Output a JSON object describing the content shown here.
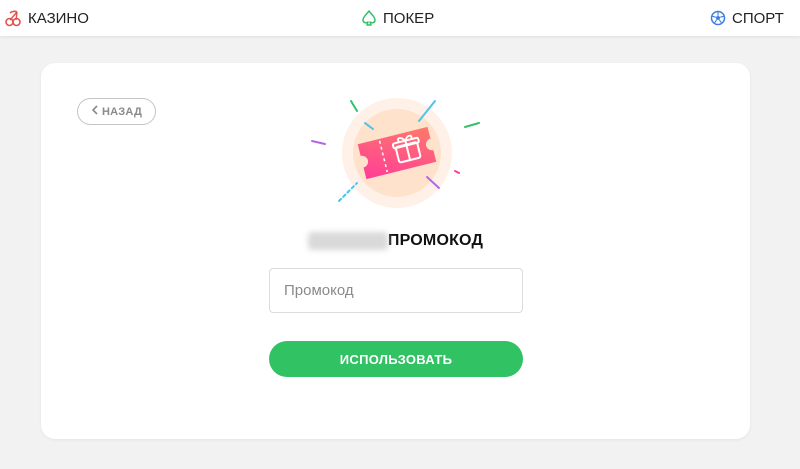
{
  "nav": {
    "casino": {
      "label": "КАЗИНО",
      "icon": "cherries-icon",
      "color": "#e0534f"
    },
    "poker": {
      "label": "ПОКЕР",
      "icon": "spade-icon",
      "color": "#33c16a"
    },
    "sport": {
      "label": "СПОРТ",
      "icon": "soccer-ball-icon",
      "color": "#3d7fe0"
    }
  },
  "promo": {
    "back_label": "НАЗАД",
    "title": "ПРОМОКОД",
    "input_placeholder": "Промокод",
    "input_value": "",
    "submit_label": "ИСПОЛЬЗОВАТЬ",
    "hero_icon": "gift-ticket-icon",
    "accent_color": "#30c263",
    "ticket_color": "#ff3d98"
  }
}
